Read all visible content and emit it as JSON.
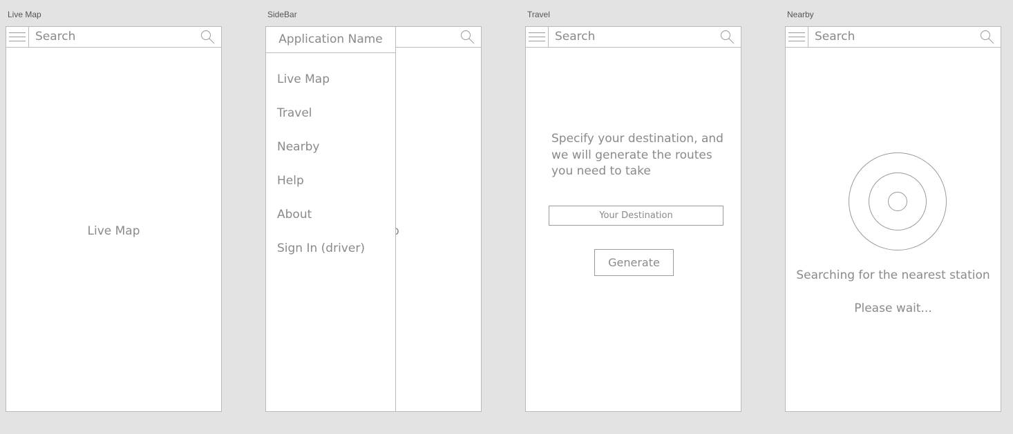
{
  "screens": {
    "live_map": {
      "label": "Live Map",
      "search_placeholder": "Search",
      "map_text": "Live Map"
    },
    "sidebar": {
      "label": "SideBar",
      "app_name": "Application Name",
      "items": [
        "Live Map",
        "Travel",
        "Nearby",
        "Help",
        "About",
        "Sign In (driver)"
      ],
      "peek_text": "p"
    },
    "travel": {
      "label": "Travel",
      "search_placeholder": "Search",
      "instruction": "Specify your destination, and we will generate the routes you need to take",
      "destination_placeholder": "Your Destination",
      "generate_label": "Generate"
    },
    "nearby": {
      "label": "Nearby",
      "search_placeholder": "Search",
      "status": "Searching for the nearest station",
      "wait": "Please wait..."
    }
  },
  "icons": [
    "menu-icon",
    "search-icon",
    "radar-icon"
  ],
  "colors": {
    "background": "#e3e3e3",
    "frame_border": "#b9b9b9",
    "text": "#8a8a8a"
  }
}
